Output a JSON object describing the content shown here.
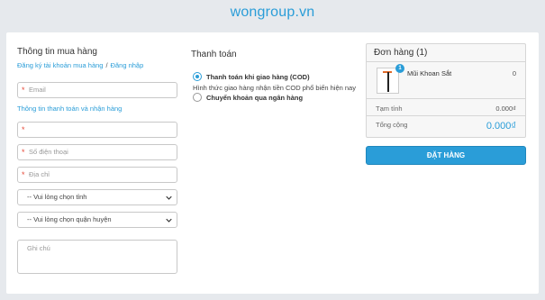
{
  "site": {
    "title": "wongroup.vn"
  },
  "customer": {
    "heading": "Thông tin mua hàng",
    "register_link": "Đăng ký tài khoản mua hàng",
    "separator": "/",
    "login_link": "Đăng nhập",
    "email_placeholder": "Email",
    "shipping_heading": "Thông tin thanh toán và nhận hàng",
    "name_placeholder": "",
    "phone_placeholder": "Số điện thoại",
    "address_placeholder": "Địa chỉ",
    "province_selected": "-- Vui lòng chọn tỉnh",
    "district_selected": "-- Vui lòng chọn quận huyện",
    "note_placeholder": "Ghi chú",
    "required_mark": "*"
  },
  "payment": {
    "heading": "Thanh toán",
    "options": [
      {
        "label": "Thanh toán khi giao hàng (COD)",
        "selected": true
      },
      {
        "label": "Chuyển khoản qua ngân hàng",
        "selected": false
      }
    ],
    "cod_description": "Hình thức giao hàng nhận tiền COD phổ biến hiện nay"
  },
  "order": {
    "heading": "Đơn hàng (1)",
    "items": [
      {
        "name": "Mũi Khoan Sắt",
        "price": "0",
        "quantity": "1"
      }
    ],
    "subtotal_label": "Tạm tính",
    "subtotal_value": "0.000₫",
    "total_label": "Tổng cộng",
    "total_value": "0.000₫",
    "submit_label": "ĐẶT HÀNG"
  },
  "colors": {
    "accent": "#2a9dd8",
    "background": "#e6e9ed",
    "required": "#e74c3c"
  }
}
